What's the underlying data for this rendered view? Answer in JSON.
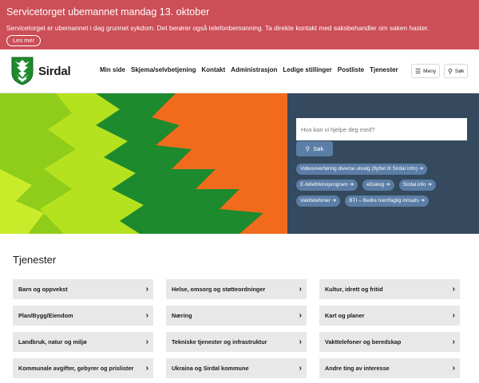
{
  "alert": {
    "title": "Servicetorget ubemannet mandag 13. oktober",
    "text": "Servicetorget er ubemannet i dag grunnet sykdom. Det berører også telefonbemanning. Ta direkte kontakt med saksbehandler om saken haster.",
    "button": "Les mer",
    "color": "#cc4e57"
  },
  "header": {
    "logo_text": "Sirdal",
    "nav": [
      "Min side",
      "Skjema/selvbetjening",
      "Kontakt",
      "Administrasjon",
      "Ledige stillinger",
      "Postliste",
      "Tjenester"
    ],
    "menu_label": "Meny",
    "search_label": "Søk"
  },
  "hero": {
    "search_placeholder": "Hva kan vi hjelpe deg med?",
    "search_button": "Søk",
    "quick_links": [
      "Videooverføring diverse utvalg (flyttet til Sirdal Info)",
      "E-billett/kinoprogram",
      "eDialog",
      "Sirdal.info",
      "Vakttelefoner",
      "BTI – Bedre tverrfaglig innsats"
    ],
    "panel_color": "#354a5f",
    "link_color": "#5b7ea6"
  },
  "services": {
    "title": "Tjenester",
    "items": [
      "Barn og oppvekst",
      "Helse, omsorg og støtteordninger",
      "Kultur, idrett og fritid",
      "Plan/Bygg/Eiendom",
      "Næring",
      "Kart og planer",
      "Landbruk, natur og miljø",
      "Tekniske tjenester og infrastruktur",
      "Vakttelefoner og beredskap",
      "Kommunale avgifter, gebyrer og prislister",
      "Ukraina og Sirdal kommune",
      "Andre ting av interesse"
    ]
  }
}
